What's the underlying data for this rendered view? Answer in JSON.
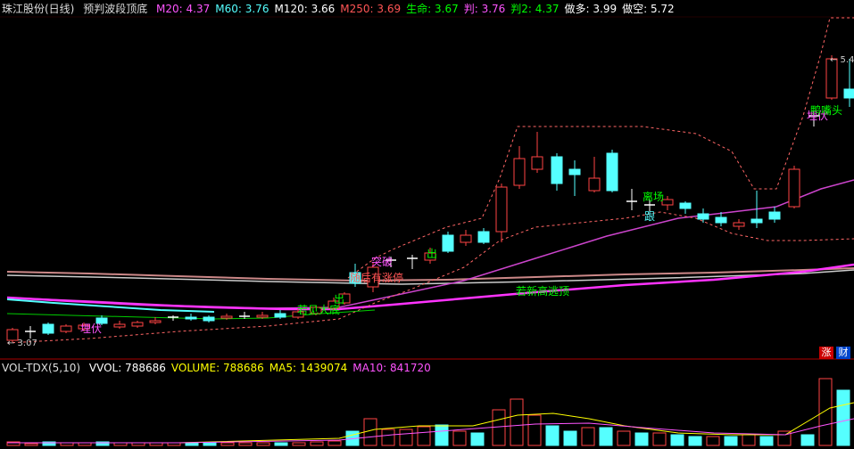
{
  "main_header": {
    "stock": "珠江股份(日线)",
    "indicator": "预判波段顶底",
    "items": [
      {
        "label": "M20: 4.37",
        "color": "#ff55ff"
      },
      {
        "label": "M60: 3.76",
        "color": "#55ffff"
      },
      {
        "label": "M120: 3.66",
        "color": "#ffffff"
      },
      {
        "label": "M250: 3.69",
        "color": "#ff5555"
      },
      {
        "label": "生命: 3.67",
        "color": "#00ff00"
      },
      {
        "label": "判: 3.76",
        "color": "#ff55ff"
      },
      {
        "label": "判2: 4.37",
        "color": "#00ff00"
      },
      {
        "label": "做多: 3.99",
        "color": "#ffffff"
      },
      {
        "label": "做空: 5.72",
        "color": "#ffffff"
      }
    ]
  },
  "vol_header": {
    "name": "VOL-TDX(5,10)",
    "items": [
      {
        "label": "VVOL: 788686",
        "color": "#ffffff"
      },
      {
        "label": "VOLUME: 788686",
        "color": "#ffff00"
      },
      {
        "label": "MA5: 1439074",
        "color": "#ffff00"
      },
      {
        "label": "MA10: 841720",
        "color": "#ff55ff"
      }
    ]
  },
  "price_labels": {
    "low": "3.07",
    "high": "5.4"
  },
  "annotations": [
    {
      "text": "埋伏",
      "color": "#ff55ff"
    },
    {
      "text": "若见大底",
      "color": "#00ff00"
    },
    {
      "text": "出",
      "color": "#00ff00"
    },
    {
      "text": "突破",
      "color": "#ff55ff"
    },
    {
      "text": "随后有涨停",
      "color": "#ff5555"
    },
    {
      "text": "出",
      "color": "#00ff00"
    },
    {
      "text": "若新高逃顶",
      "color": "#00ff00"
    },
    {
      "text": "离场",
      "color": "#00ff00"
    },
    {
      "text": "跟",
      "color": "#55ffff"
    },
    {
      "text": "埋伏",
      "color": "#ff55ff"
    },
    {
      "text": "鸭嘴头",
      "color": "#00ff00"
    }
  ],
  "side_tags": {
    "up": "涨",
    "finance": "财"
  }
}
